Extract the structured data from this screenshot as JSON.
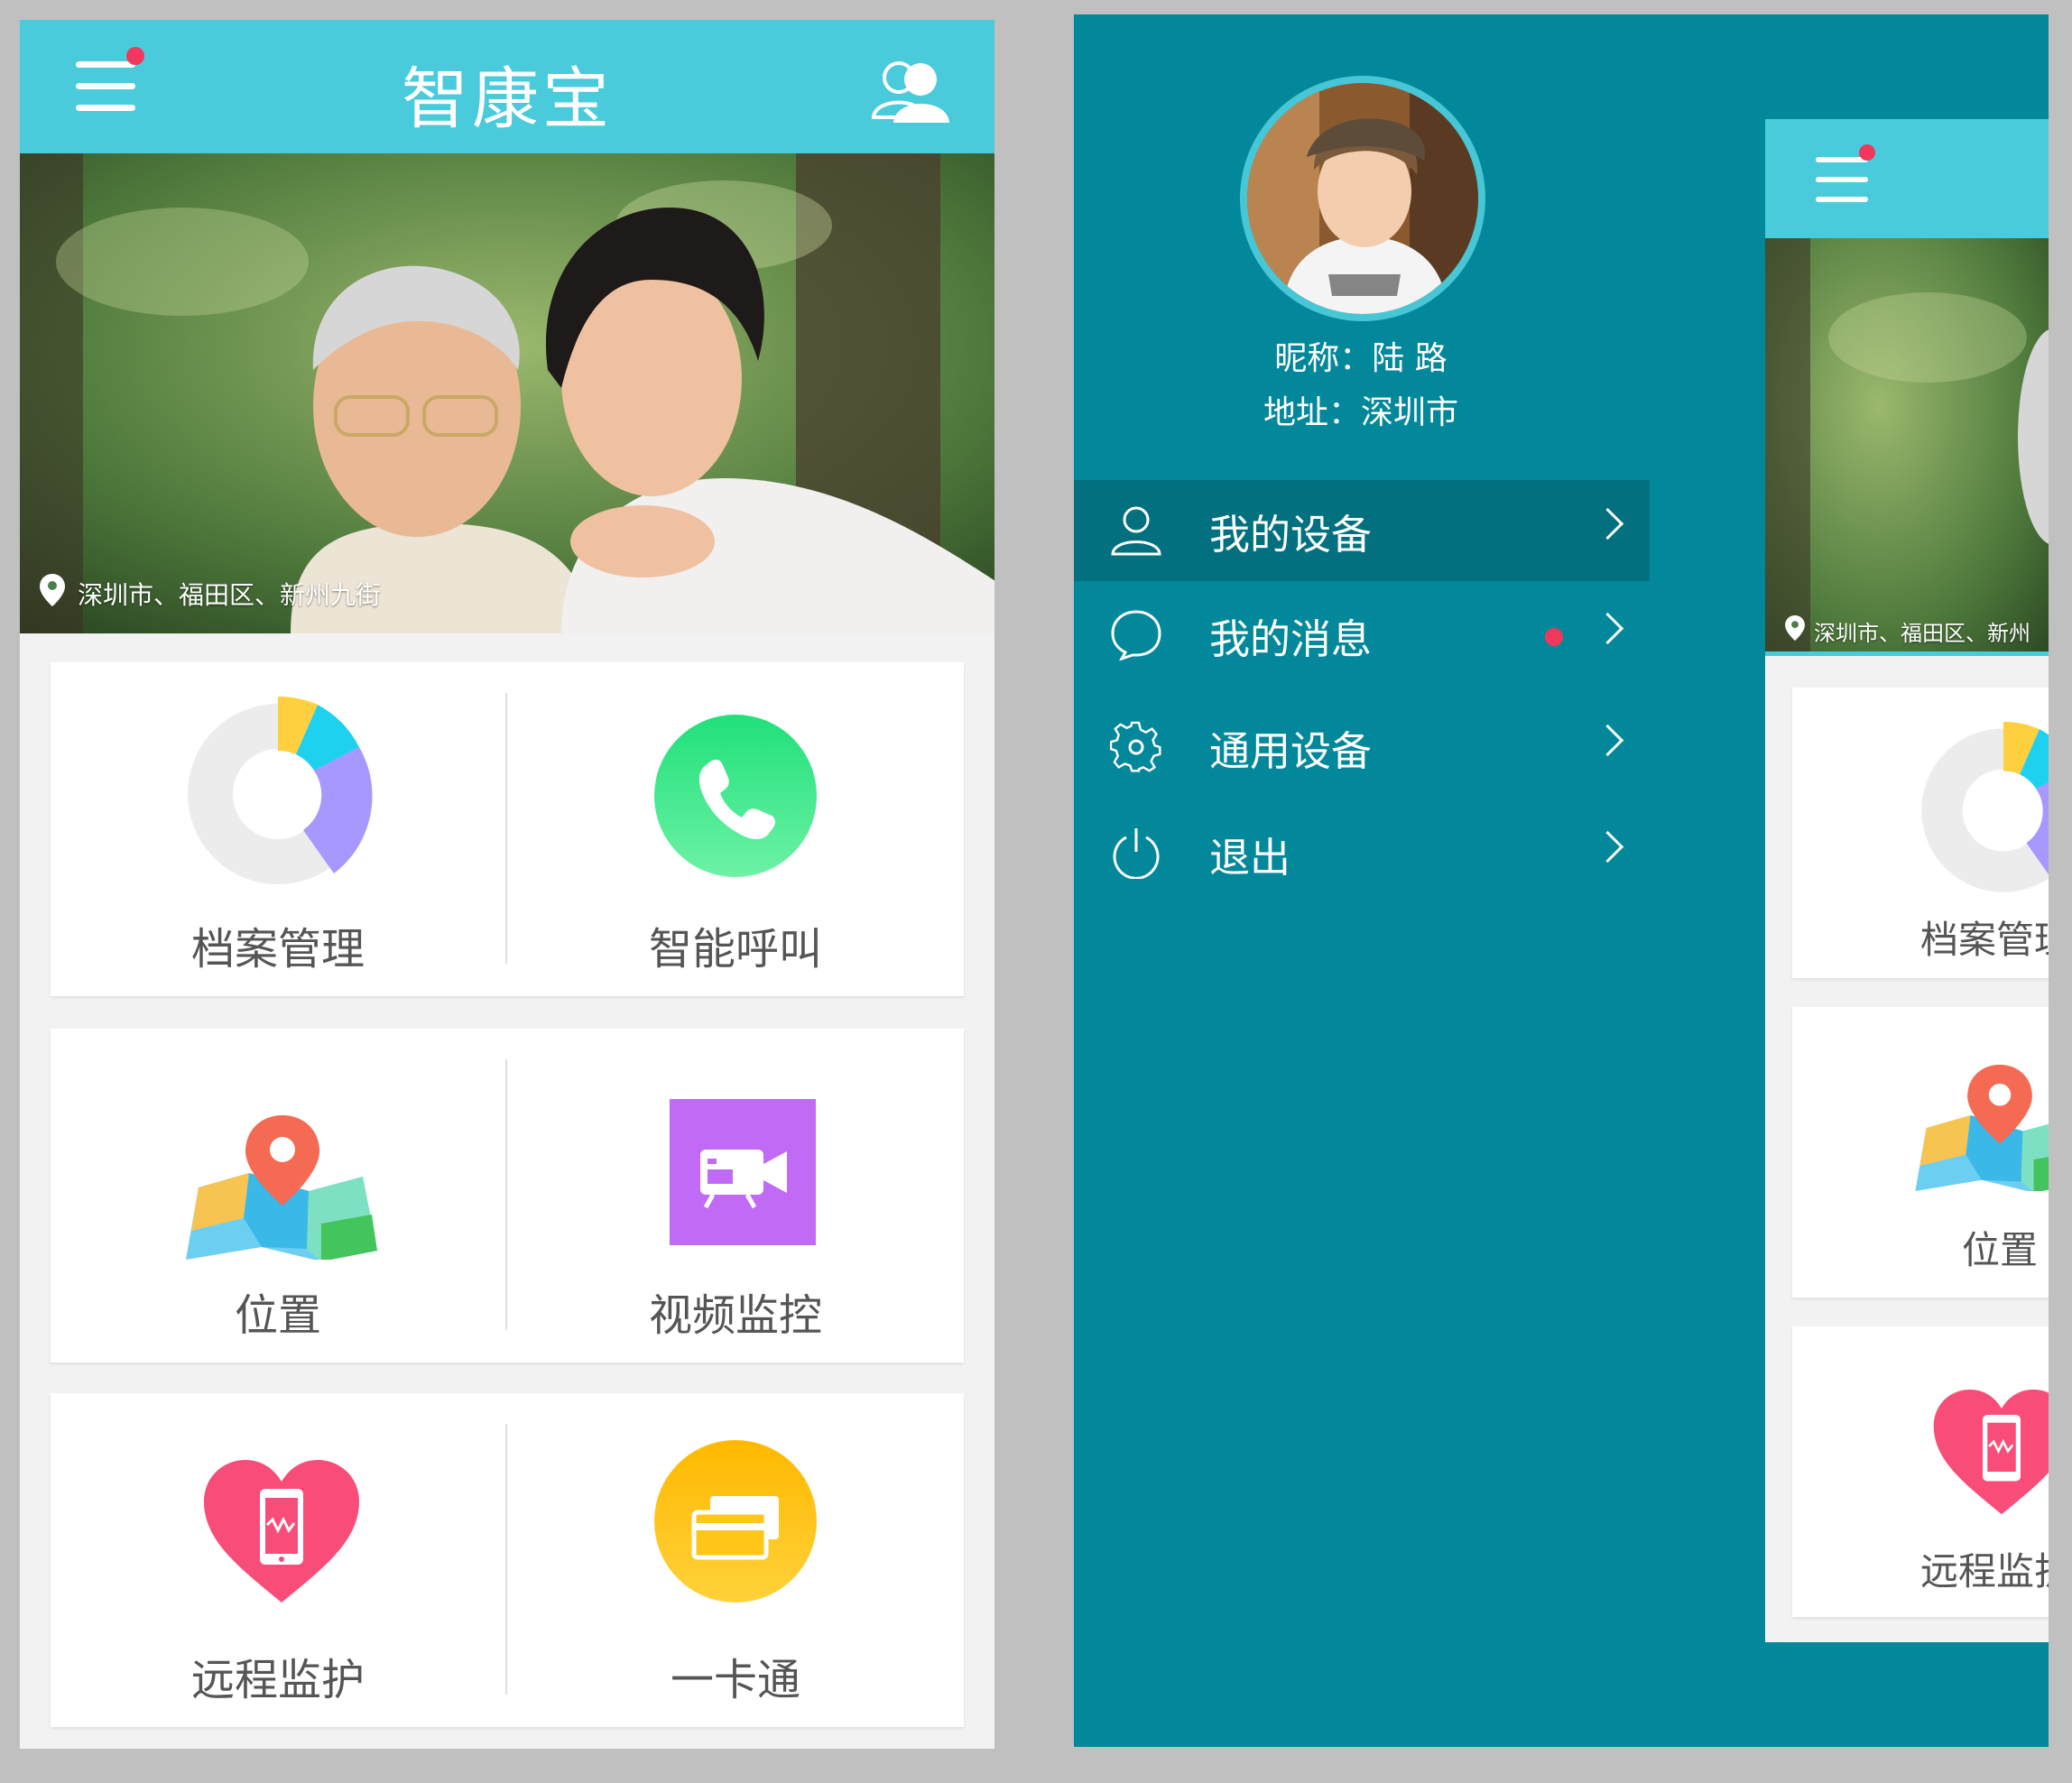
{
  "app": {
    "title": "智康宝",
    "location": "深圳市、福田区、新州九街",
    "location_peek": "深圳市、福田区、新州",
    "colors": {
      "header": "#49cbdb",
      "drawer": "#02889a",
      "accent_dot": "#f0385c"
    }
  },
  "tiles": [
    {
      "label": "档案管理",
      "icon": "donut-chart-icon"
    },
    {
      "label": "智能呼叫",
      "icon": "phone-icon"
    },
    {
      "label": "位置",
      "icon": "map-pin-icon"
    },
    {
      "label": "视频监控",
      "icon": "video-camera-icon"
    },
    {
      "label": "远程监护",
      "icon": "heart-phone-icon"
    },
    {
      "label": "一卡通",
      "icon": "cards-icon"
    }
  ],
  "peek_tiles": [
    {
      "label": "档案管理"
    },
    {
      "label": "位置"
    },
    {
      "label": "远程监护"
    }
  ],
  "drawer": {
    "nickname": "昵称：陆 路",
    "address": "地址：深圳市",
    "menu": [
      {
        "label": "我的设备",
        "icon": "user-icon",
        "active": true
      },
      {
        "label": "我的消息",
        "icon": "message-icon",
        "unread": true
      },
      {
        "label": "通用设备",
        "icon": "gear-icon"
      },
      {
        "label": "退出",
        "icon": "power-icon"
      }
    ]
  }
}
